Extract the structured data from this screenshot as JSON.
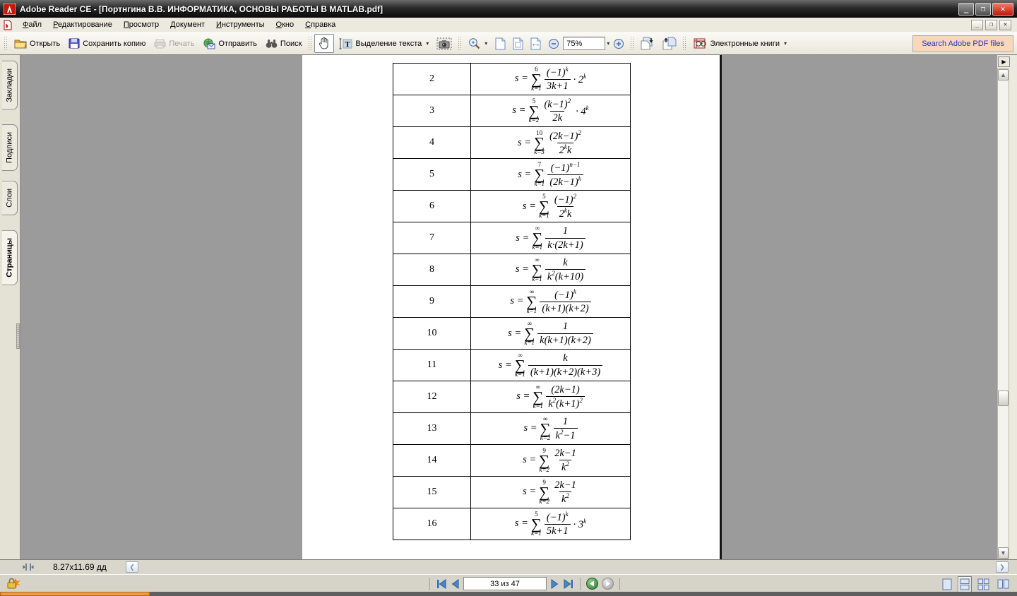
{
  "window": {
    "title": "Adobe Reader CE - [Портнгина В.В. ИНФОРМАТИКА, ОСНОВЫ РАБОТЫ В MATLAB.pdf]",
    "minimize": "_",
    "restore": "❐",
    "close": "✕"
  },
  "menu": {
    "items": [
      {
        "label": "Файл"
      },
      {
        "label": "Редактирование"
      },
      {
        "label": "Просмотр"
      },
      {
        "label": "Документ"
      },
      {
        "label": "Инструменты"
      },
      {
        "label": "Окно"
      },
      {
        "label": "Справка"
      }
    ]
  },
  "toolbar": {
    "open": "Открыть",
    "save_copy": "Сохранить копию",
    "print": "Печать",
    "send": "Отправить",
    "search": "Поиск",
    "text_select": "Выделение текста",
    "zoom_value": "75%",
    "ebooks": "Электронные книги",
    "search_adobe": "Search Adobe PDF files",
    "dropdown_glyph": "▾",
    "overflow_glyph": "▶"
  },
  "sidebar": {
    "tabs": [
      {
        "label": "Закладки"
      },
      {
        "label": "Подписи"
      },
      {
        "label": "Слои"
      },
      {
        "label": "Страницы"
      }
    ]
  },
  "content": {
    "table": {
      "lhs": "s =",
      "sigma": "∑",
      "rows": [
        {
          "num": "2",
          "upper": "6",
          "lower": "k=1",
          "numerator": "(−1)^{k}",
          "denominator": "3k+1",
          "factor": "· 2^{k}"
        },
        {
          "num": "3",
          "upper": "5",
          "lower": "k=2",
          "numerator": "(k−1)^{2}",
          "denominator": "2k",
          "factor": "· 4^{k}"
        },
        {
          "num": "4",
          "upper": "10",
          "lower": "k=3",
          "numerator": "(2k−1)^{2}",
          "denominator": "2^{k}k",
          "factor": ""
        },
        {
          "num": "5",
          "upper": "7",
          "lower": "k=1",
          "numerator": "(−1)^{n−1}",
          "denominator": "(2k−1)^{k}",
          "factor": ""
        },
        {
          "num": "6",
          "upper": "5",
          "lower": "k=1",
          "numerator": "(−1)^{2}",
          "denominator": "2^{k}k",
          "factor": ""
        },
        {
          "num": "7",
          "upper": "∞",
          "lower": "k=1",
          "numerator": "1",
          "denominator": "k·(2k+1)",
          "factor": ""
        },
        {
          "num": "8",
          "upper": "∞",
          "lower": "k=1",
          "numerator": "k",
          "denominator": "k^{2}(k+10)",
          "factor": ""
        },
        {
          "num": "9",
          "upper": "∞",
          "lower": "k=1",
          "numerator": "(−1)^{k}",
          "denominator": "(k+1)(k+2)",
          "factor": ""
        },
        {
          "num": "10",
          "upper": "∞",
          "lower": "k=1",
          "numerator": "1",
          "denominator": "k(k+1)(k+2)",
          "factor": ""
        },
        {
          "num": "11",
          "upper": "∞",
          "lower": "k=1",
          "numerator": "k",
          "denominator": "(k+1)(k+2)(k+3)",
          "factor": ""
        },
        {
          "num": "12",
          "upper": "∞",
          "lower": "k=1",
          "numerator": "(2k−1)",
          "denominator": "k^{2}(k+1)^{2}",
          "factor": ""
        },
        {
          "num": "13",
          "upper": "∞",
          "lower": "k=2",
          "numerator": "1",
          "denominator": "k^{2}−1",
          "factor": ""
        },
        {
          "num": "14",
          "upper": "9",
          "lower": "k=2",
          "numerator": "2k−1",
          "denominator": "k^{2}",
          "factor": ""
        },
        {
          "num": "15",
          "upper": "9",
          "lower": "k=2",
          "numerator": "2k−1",
          "denominator": "k^{2}",
          "factor": ""
        },
        {
          "num": "16",
          "upper": "5",
          "lower": "k=1",
          "numerator": "(−1)^{k}",
          "denominator": "5k+1",
          "factor": "· 3^{k}"
        }
      ]
    }
  },
  "status": {
    "page_size": "8.27x11.69 дд",
    "chevron_left": "❮",
    "chevron_right": "❯"
  },
  "nav": {
    "page_field": "33 из 47"
  },
  "colors": {
    "accent_red": "#cc1111",
    "search_btn_bg": "#f9d8ba",
    "search_btn_text": "#2233bb",
    "doc_bg": "#9b9b9b",
    "strip_orange": "#ed9b40"
  }
}
